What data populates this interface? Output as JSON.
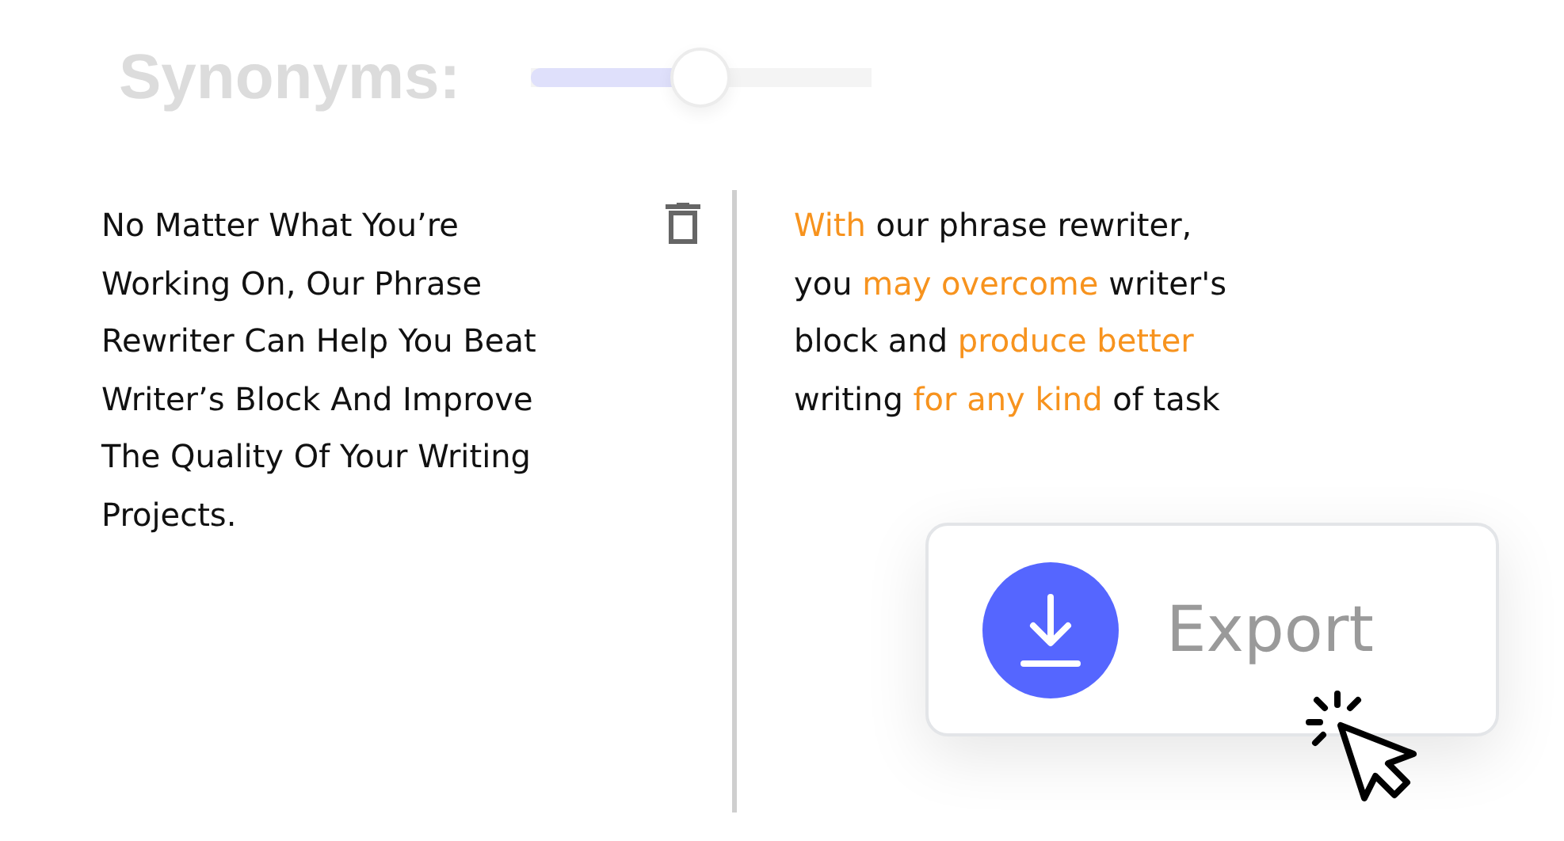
{
  "synonyms": {
    "label": "Synonyms:",
    "level": 0.5
  },
  "input_lines": [
    "No Matter What You’re",
    "Working On, Our Phrase",
    "Rewriter Can Help You Beat",
    "Writer’s Block And Improve",
    "The Quality Of Your Writing",
    "Projects."
  ],
  "output_lines": [
    [
      {
        "text": "With",
        "highlighted": true
      },
      {
        "text": " our phrase rewriter,",
        "highlighted": false
      }
    ],
    [
      {
        "text": "you ",
        "highlighted": false
      },
      {
        "text": "may overcome",
        "highlighted": true
      },
      {
        "text": " writer's",
        "highlighted": false
      }
    ],
    [
      {
        "text": "block and ",
        "highlighted": false
      },
      {
        "text": "produce better",
        "highlighted": true
      }
    ],
    [
      {
        "text": "writing ",
        "highlighted": false
      },
      {
        "text": "for any kind",
        "highlighted": true
      },
      {
        "text": " of task",
        "highlighted": false
      }
    ]
  ],
  "export_button": {
    "label": "Export"
  }
}
